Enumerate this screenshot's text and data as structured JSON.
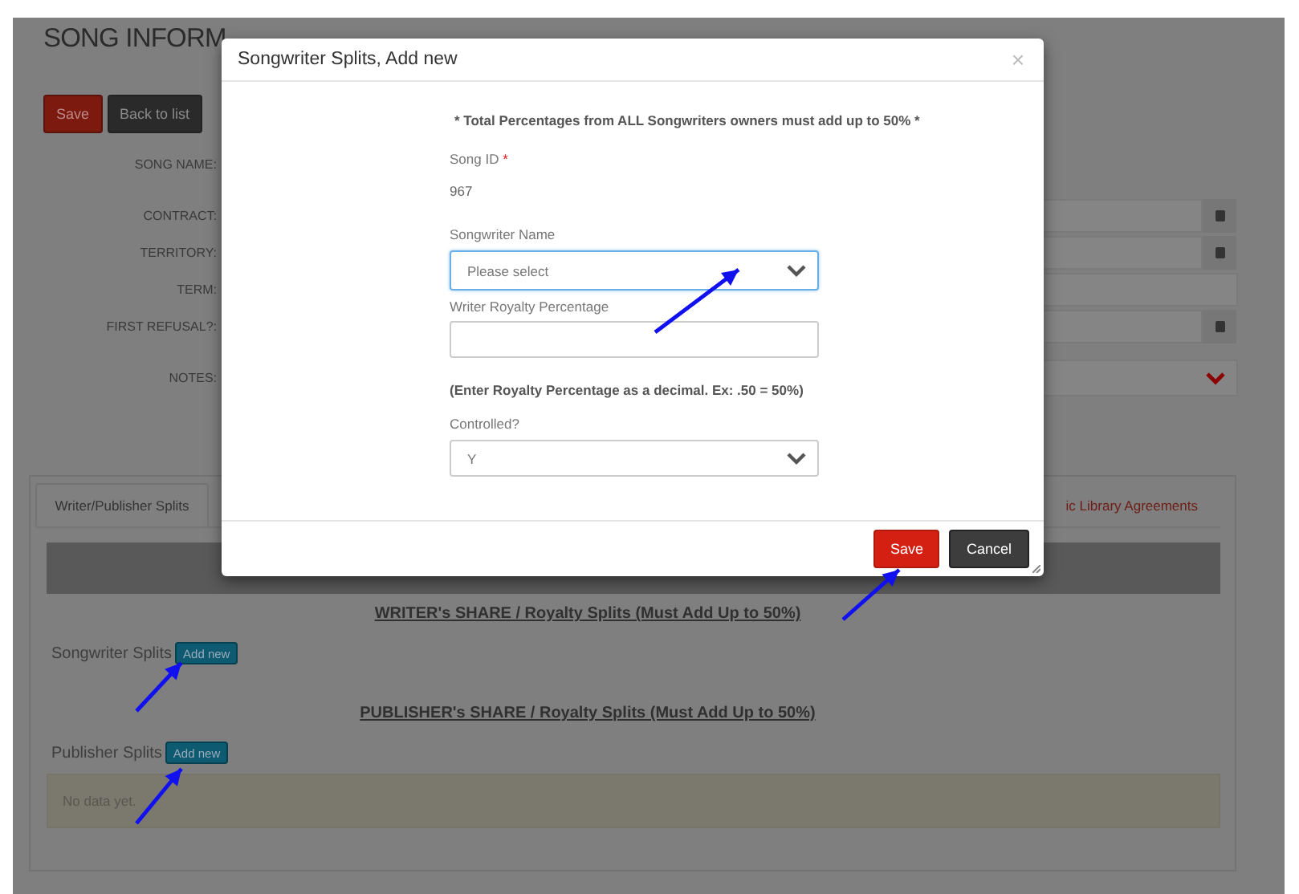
{
  "page": {
    "title": "SONG INFORM",
    "buttons": [
      {
        "label": "Save",
        "kind": "danger"
      },
      {
        "label": "Back to list",
        "kind": "dark"
      }
    ],
    "form_rows": [
      {
        "label": "SONG NAME:",
        "kind": "name"
      },
      {
        "label": "CONTRACT:",
        "kind": "date"
      },
      {
        "label": "TERRITORY:",
        "kind": "date"
      },
      {
        "label": "TERM:",
        "kind": "text"
      },
      {
        "label": "FIRST REFUSAL?:",
        "kind": "date"
      },
      {
        "label": "NOTES:",
        "kind": "select"
      }
    ]
  },
  "tabs": [
    {
      "label": "Writer/Publisher Splits",
      "selected": true
    },
    {
      "label": "ic Library Agreements",
      "selected": false
    }
  ],
  "splits": [
    {
      "heading": "WRITER's SHARE / Royalty Splits (Must Add Up to 50%)",
      "label": "Songwriter Splits",
      "button": "Add new"
    },
    {
      "heading": "PUBLISHER's SHARE / Royalty Splits (Must Add Up to 50%)",
      "label": "Publisher Splits",
      "button": "Add new",
      "empty": "No data yet."
    }
  ],
  "modal": {
    "title": "Songwriter Splits, Add new",
    "close": "×",
    "notice": "* Total Percentages from ALL Songwriters owners must add up to 50% *",
    "song_id": {
      "label": "Song ID",
      "required_mark": "*",
      "value": "967"
    },
    "songwriter_name": {
      "label": "Songwriter Name",
      "placeholder": "Please select"
    },
    "royalty": {
      "label": "Writer Royalty Percentage",
      "hint": "(Enter Royalty Percentage as a decimal. Ex: .50 = 50%)"
    },
    "controlled": {
      "label": "Controlled?",
      "value": "Y"
    },
    "buttons": [
      {
        "label": "Save",
        "kind": "danger"
      },
      {
        "label": "Cancel",
        "kind": "dark"
      }
    ]
  }
}
